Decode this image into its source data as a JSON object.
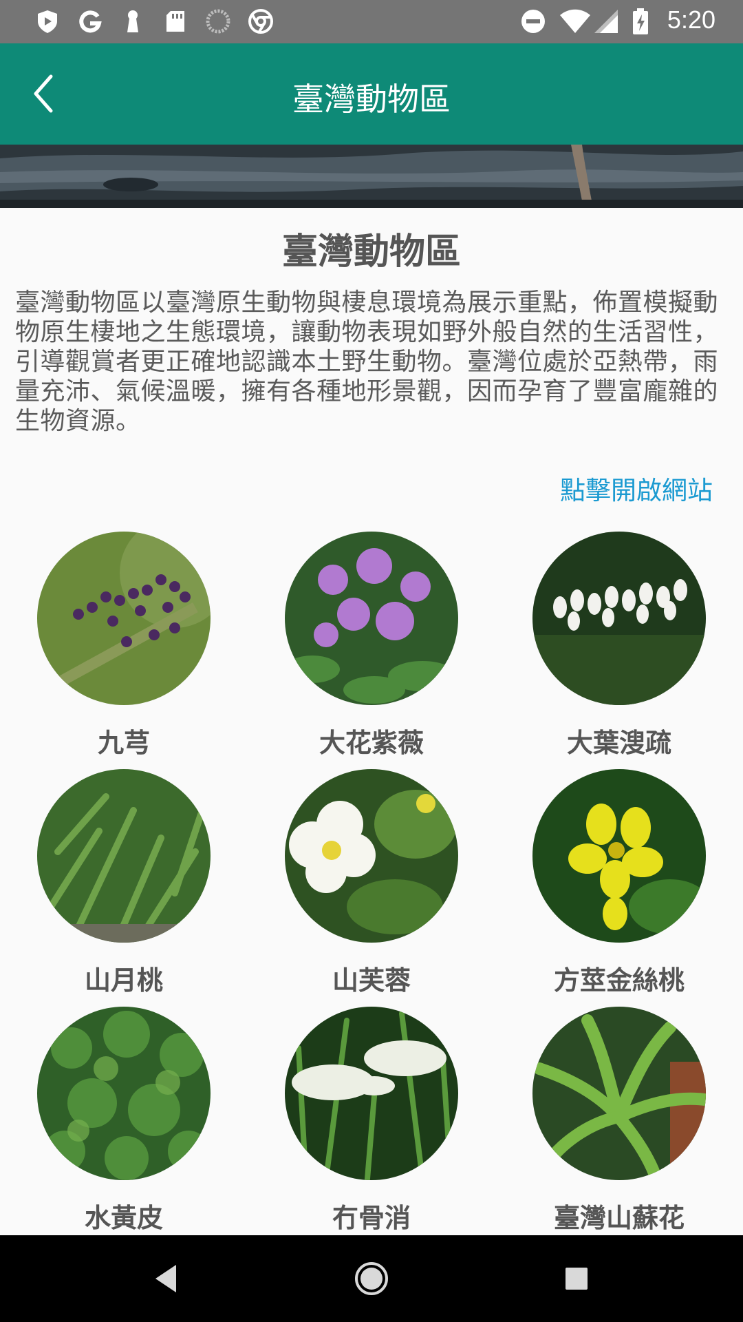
{
  "status_bar": {
    "time": "5:20",
    "left_icons": [
      "play-protect-icon",
      "google-icon",
      "keyhole-icon",
      "sd-card-icon",
      "loading-icon",
      "chrome-icon"
    ],
    "right_icons": [
      "do-not-disturb-icon",
      "wifi-icon",
      "signal-icon",
      "battery-charging-icon"
    ]
  },
  "app_bar": {
    "title": "臺灣動物區"
  },
  "content": {
    "title": "臺灣動物區",
    "description": "臺灣動物區以臺灣原生動物與棲息環境為展示重點，佈置模擬動物原生棲地之生態環境，讓動物表現如野外般自然的生活習性，引導觀賞者更正確地認識本土野生動物。臺灣位處於亞熱帶，雨量充沛、氣候溫暖，擁有各種地形景觀，因而孕育了豐富龐雜的生物資源。",
    "link_label": "點擊開啟網站"
  },
  "plants": [
    {
      "name": "九芎"
    },
    {
      "name": "大花紫薇"
    },
    {
      "name": "大葉溲疏"
    },
    {
      "name": "山月桃"
    },
    {
      "name": "山芙蓉"
    },
    {
      "name": "方莖金絲桃"
    },
    {
      "name": "水黃皮"
    },
    {
      "name": "冇骨消"
    },
    {
      "name": "臺灣山蘇花"
    }
  ],
  "colors": {
    "app_bar": "#0e8a77",
    "link": "#1b9ad1",
    "status_bar": "#757575"
  }
}
